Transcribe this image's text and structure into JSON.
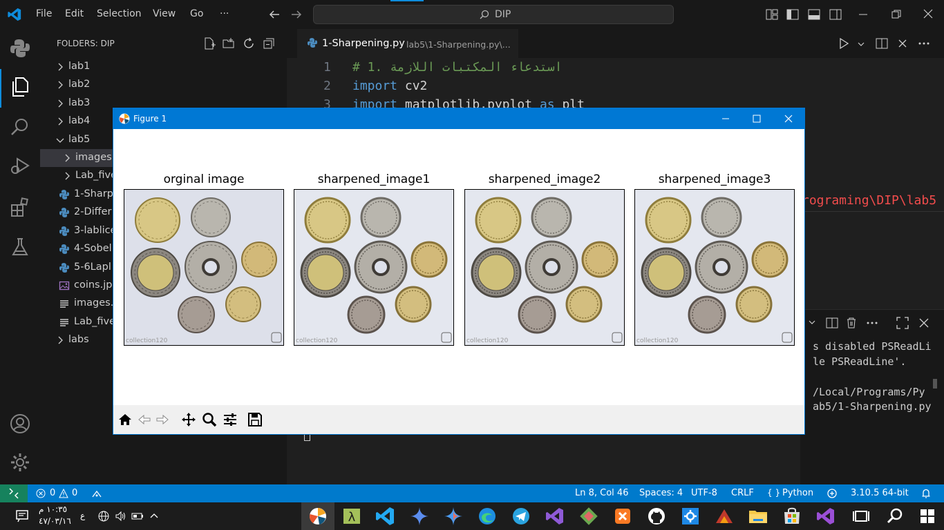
{
  "titlebar": {
    "menu": [
      "File",
      "Edit",
      "Selection",
      "View",
      "Go",
      "···"
    ],
    "search_text": "DIP"
  },
  "explorer": {
    "header": "FOLDERS: DIP",
    "items": [
      {
        "label": "lab1",
        "type": "folder",
        "expanded": false,
        "depth": 0
      },
      {
        "label": "lab2",
        "type": "folder",
        "expanded": false,
        "depth": 0
      },
      {
        "label": "lab3",
        "type": "folder",
        "expanded": false,
        "depth": 0
      },
      {
        "label": "lab4",
        "type": "folder",
        "expanded": false,
        "depth": 0
      },
      {
        "label": "lab5",
        "type": "folder",
        "expanded": true,
        "depth": 0
      },
      {
        "label": "images",
        "type": "folder",
        "expanded": false,
        "depth": 1,
        "selected": true
      },
      {
        "label": "Lab_five",
        "type": "folder",
        "expanded": false,
        "depth": 1
      },
      {
        "label": "1-Sharp",
        "type": "python",
        "depth": 1
      },
      {
        "label": "2-Differ",
        "type": "python",
        "depth": 1
      },
      {
        "label": "3-lablice",
        "type": "python",
        "depth": 1
      },
      {
        "label": "4-Sobel",
        "type": "python",
        "depth": 1
      },
      {
        "label": "5-6Lapl",
        "type": "python",
        "depth": 1
      },
      {
        "label": "coins.jpg",
        "type": "image",
        "depth": 1
      },
      {
        "label": "images.r",
        "type": "text",
        "depth": 1
      },
      {
        "label": "Lab_five",
        "type": "text",
        "depth": 1
      },
      {
        "label": "labs",
        "type": "folder",
        "expanded": false,
        "depth": 0
      }
    ]
  },
  "editor": {
    "tab_name": "1-Sharpening.py",
    "tab_path": "lab5\\1-Sharpening.py\\...",
    "lines": [
      {
        "num": "1",
        "parts": [
          {
            "t": "# 1. ",
            "c": "#6a9955"
          },
          {
            "t": "استدعاء المكتبات اللازمة",
            "c": "#6a9955"
          }
        ]
      },
      {
        "num": "2",
        "parts": [
          {
            "t": "import",
            "c": "#569cd6"
          },
          {
            "t": " cv2",
            "c": "#d4d4d4"
          }
        ]
      },
      {
        "num": "3",
        "parts": [
          {
            "t": "import",
            "c": "#569cd6"
          },
          {
            "t": " matplotlib.pyplot ",
            "c": "#d4d4d4"
          },
          {
            "t": "as",
            "c": "#569cd6"
          },
          {
            "t": " plt",
            "c": "#d4d4d4"
          }
        ]
      }
    ],
    "error_fragment": "rograming\\DIP\\lab5"
  },
  "terminal": {
    "lines": [
      "s disabled PSReadLi",
      "le PSReadLine'.",
      "",
      "/Local/Programs/Py",
      "ab5/1-Sharpening.py"
    ]
  },
  "figure": {
    "window_title": "Figure 1",
    "subplots": [
      {
        "title": "orginal image",
        "variant": "original"
      },
      {
        "title": "sharpened_image1",
        "variant": "sharp"
      },
      {
        "title": "sharpened_image2",
        "variant": "sharp"
      },
      {
        "title": "sharpened_image3",
        "variant": "sharp"
      }
    ],
    "watermark": "collection120"
  },
  "statusbar": {
    "errors": "0",
    "warnings": "0",
    "cursor": "Ln 8, Col 46",
    "spaces": "Spaces: 4",
    "encoding": "UTF-8",
    "eol": "CRLF",
    "language": "Python",
    "interpreter": "3.10.5 64-bit"
  },
  "taskbar": {
    "time": "١٠:٣٥ م",
    "date": "٤٧/٠٣/١٦",
    "lang": "ع"
  },
  "colors": {
    "accent": "#007acc",
    "figure_title": "#0078d4",
    "comment": "#6a9955",
    "keyword": "#569cd6"
  }
}
